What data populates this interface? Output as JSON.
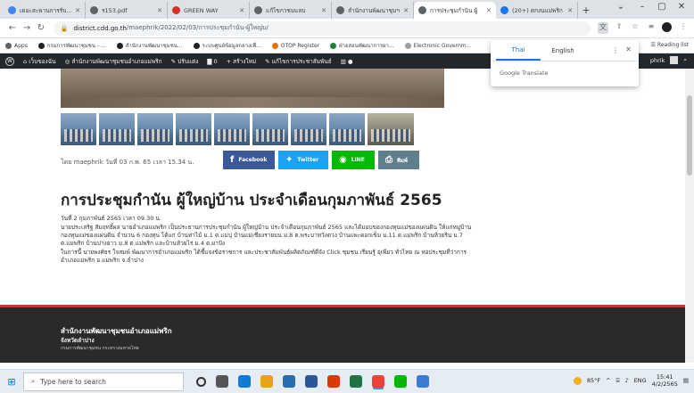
{
  "browser": {
    "tabs": [
      {
        "label": "เดอะสะพานการรับฟัง",
        "icon": "chrome-icon",
        "color": "#4285f4",
        "active": false
      },
      {
        "label": "ร153.pdf",
        "icon": "globe-icon",
        "color": "#5f6368",
        "active": false
      },
      {
        "label": "GREEN WAY",
        "icon": "drive-icon",
        "color": "#d93025",
        "active": false
      },
      {
        "label": "แก้ไขกวชมแลบ",
        "icon": "globe-icon",
        "color": "#5f6368",
        "active": false
      },
      {
        "label": "สำนักงานพัฒนาชุมฯ",
        "icon": "globe-icon",
        "color": "#5f6368",
        "active": false
      },
      {
        "label": "การประชุมกำนัน ผู้",
        "icon": "globe-icon",
        "color": "#5f6368",
        "active": true
      },
      {
        "label": "(20+) ตกงนแม่พริก",
        "icon": "facebook-icon",
        "color": "#1877f2",
        "active": false
      }
    ],
    "url_host": "district.cdd.go.th",
    "url_path": "/maephrik/2022/02/03/การประชุมกำนัน-ผู้ใหญ่บ/",
    "bookmarks": [
      {
        "label": "Apps",
        "color": "#5f6368"
      },
      {
        "label": "กรมการพัฒนาชุมชน - ...",
        "color": "#202124"
      },
      {
        "label": "สำนักงานพัฒนาชุมชน...",
        "color": "#202124"
      },
      {
        "label": "ระบบศูนย์ข้อมูลกลางเพื่...",
        "color": "#202124"
      },
      {
        "label": "OTOP Register",
        "color": "#e37400"
      },
      {
        "label": "ฝ่ายสอนพัฒนาการผา...",
        "color": "#188038"
      },
      {
        "label": "Electronic Governm...",
        "color": "#9aa0a6"
      }
    ],
    "reading_list": "Reading list"
  },
  "wp_bar": {
    "items": [
      "เว็บของฉัน",
      "สำนักงานพัฒนาชุมชนอำเภอแม่พริก",
      "ปรับแต่ง",
      "0",
      "สร้างใหม่",
      "แก้ไขการประชาสัมพันธ์"
    ],
    "user": "phrik"
  },
  "translate": {
    "lang_from": "Thai",
    "lang_to": "English",
    "brand": "Google Translate"
  },
  "post": {
    "meta": "โดย maephrik วันที่ 03 ก.พ. 65 เวลา 15.34 น.",
    "share_buttons": [
      {
        "label": "Facebook",
        "icon": "facebook-icon",
        "color": "#3b5998"
      },
      {
        "label": "Twitter",
        "icon": "twitter-icon",
        "color": "#1da1f2"
      },
      {
        "label": "LINE",
        "icon": "line-icon",
        "color": "#00b900"
      },
      {
        "label": "พิมพ์",
        "icon": "print-icon",
        "color": "#5f7f8a"
      }
    ],
    "title": "การประชุมกำนัน ผู้ใหญ่บ้าน ประจำเดือนกุมภาพันธ์ 2565",
    "paragraphs": [
      "วันที่ 2 กุมภาพันธ์ 2565 เวลา 09.30 น.",
      "นายประเสริฐ สัมฤทธิ์ผล นายอำเภอแม่พริก เป็นประธานการประชุมกำนัน ผู้ใหญ่บ้าน ประจำเดือนกุมภาพันธ์ 2565 และได้มอบของกองทุนแม่ของแผ่นดิน ให้แก่หมู่บ้านกองทุนแม่ของแผ่นดิน จำนวน 6 กองทุน ได้แก่ บ้านท่าไม้ ม.1 ต.แม่ปุ บ้านแม่เชียงรายบน ม.8 ต.พระบาทวังตวง บ้านแพะดอกเข็ม ม.11 ต.แม่พริก บ้านห้วยริน ม.7 ต.แม่พริก บ้านปางยาว ม.8 ต.แม่พริก และบ้านห้วยไร่ ม.4 ต.ผาปัง",
      "ในการนี้ นายพงศ์ธร ใจสมพ์ พัฒนาการอำเภอแม่พริก ได้ชี้แจงข้อราชการ และประชาสัมพันธ์ผลิตภัณฑ์ดีจัง Click ชุมชน เรียนรู้ อุเพียว ทั่วไทย ณ หอประชุมที่ว่าการอำเภอแม่พริก อ.แม่พริก จ.ลำปาง"
    ]
  },
  "footer": {
    "office": "สำนักงานพัฒนาชุมชนอำเภอแม่พริก",
    "province": "จังหวัดลำปาง",
    "department": "กรมการพัฒนาชุมชน กระทรวงมหาดไทย"
  },
  "taskbar": {
    "search_placeholder": "Type here to search",
    "apps": [
      {
        "icon": "circle-icon",
        "color": "#333333"
      },
      {
        "icon": "task-view-icon",
        "color": "#555555"
      },
      {
        "icon": "edge-icon",
        "color": "#0f7bd6"
      },
      {
        "icon": "file-explorer-icon",
        "color": "#e8a21a"
      },
      {
        "icon": "store-icon",
        "color": "#2b6cb0"
      },
      {
        "icon": "word-icon",
        "color": "#2b579a"
      },
      {
        "icon": "paint-icon",
        "color": "#d83b01"
      },
      {
        "icon": "excel-icon",
        "color": "#217346"
      },
      {
        "icon": "chrome-icon",
        "color": "#e94235"
      },
      {
        "icon": "line-icon",
        "color": "#00b900"
      },
      {
        "icon": "photos-icon",
        "color": "#3a7bd5"
      }
    ],
    "weather": "85°F",
    "lang": "ENG",
    "time": "15:41",
    "date": "4/2/2565"
  }
}
